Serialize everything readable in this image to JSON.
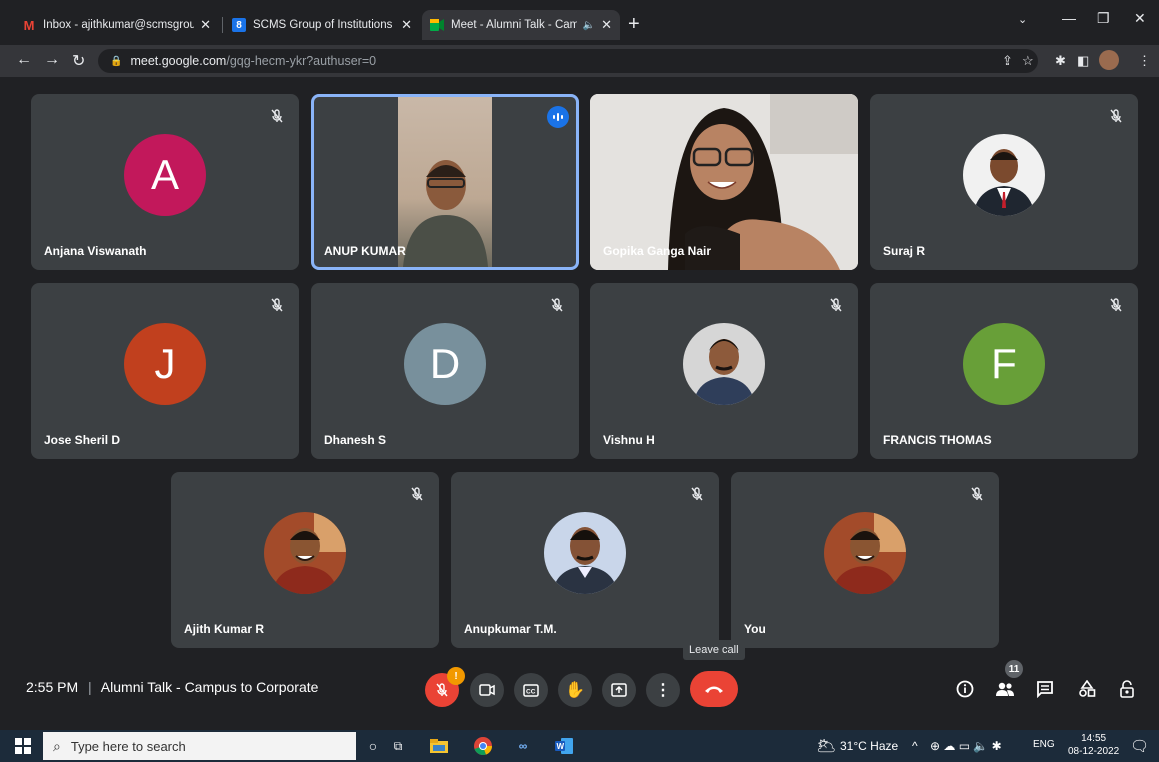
{
  "browser": {
    "tabs": [
      {
        "title": "Inbox - ajithkumar@scmsgroup.c",
        "icon": "gmail-icon"
      },
      {
        "title": "SCMS Group of Institutions - Cale",
        "icon": "calendar-icon"
      },
      {
        "title": "Meet - Alumni Talk - Campus",
        "icon": "meet-icon"
      }
    ],
    "url_host": "meet.google.com",
    "url_path": "/gqg-hecm-ykr?authuser=0"
  },
  "meeting": {
    "time": "2:55 PM",
    "separator": "|",
    "title": "Alumni Talk - Campus to Corporate",
    "leave_tooltip": "Leave call",
    "participant_count": "11",
    "mic_badge": "!"
  },
  "participants": [
    {
      "name": "Anjana Viswanath",
      "initial": "A",
      "color": "#c2185b"
    },
    {
      "name": "ANUP KUMAR",
      "video": true,
      "speaking": true
    },
    {
      "name": "Gopika Ganga Nair",
      "video": true
    },
    {
      "name": "Suraj R",
      "photo": true
    },
    {
      "name": "Jose Sheril D",
      "initial": "J",
      "color": "#c1401e"
    },
    {
      "name": "Dhanesh S",
      "initial": "D",
      "color": "#78909c"
    },
    {
      "name": "Vishnu H",
      "photo": true
    },
    {
      "name": "FRANCIS THOMAS",
      "initial": "F",
      "color": "#689f38"
    },
    {
      "name": "Ajith Kumar R",
      "photo": true
    },
    {
      "name": "Anupkumar T.M.",
      "photo": true
    },
    {
      "name": "You",
      "photo": true
    }
  ],
  "taskbar": {
    "search_placeholder": "Type here to search",
    "weather": "31°C  Haze",
    "lang": "ENG",
    "time": "14:55",
    "date": "08-12-2022"
  }
}
